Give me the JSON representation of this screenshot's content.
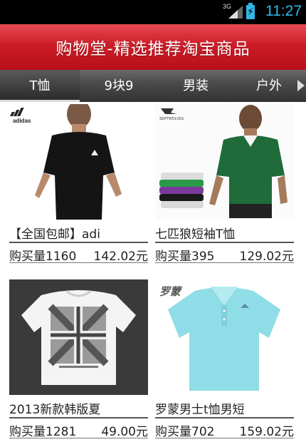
{
  "status_bar": {
    "network": "3G",
    "time": "11:27",
    "battery_icon": "battery-charging-icon",
    "signal_icon": "signal-icon"
  },
  "app_bar": {
    "title": "购物堂-精选推荐淘宝商品"
  },
  "tabs": [
    {
      "label": "T恤",
      "active": true
    },
    {
      "label": "9块9",
      "active": false
    },
    {
      "label": "男装",
      "active": false
    },
    {
      "label": "户外",
      "active": false
    }
  ],
  "products": [
    {
      "name": "【全国包邮】adi",
      "sales": "购买量1160",
      "price": "142.02元",
      "brand_mark": "adidas"
    },
    {
      "name": "七匹狼短袖T恤",
      "sales": "购买量395",
      "price": "129.02元",
      "brand_mark": "SEPTWOLVES"
    },
    {
      "name": "2013新款韩版夏",
      "sales": "购买量1281",
      "price": "49.00元",
      "brand_mark": ""
    },
    {
      "name": "罗蒙男士t恤男短",
      "sales": "购买量702",
      "price": "159.02元",
      "brand_mark": "罗蒙"
    }
  ],
  "colors": {
    "app_bar": "#cc1d27",
    "tab_bar": "#444444",
    "status_accent": "#33b5e5"
  }
}
